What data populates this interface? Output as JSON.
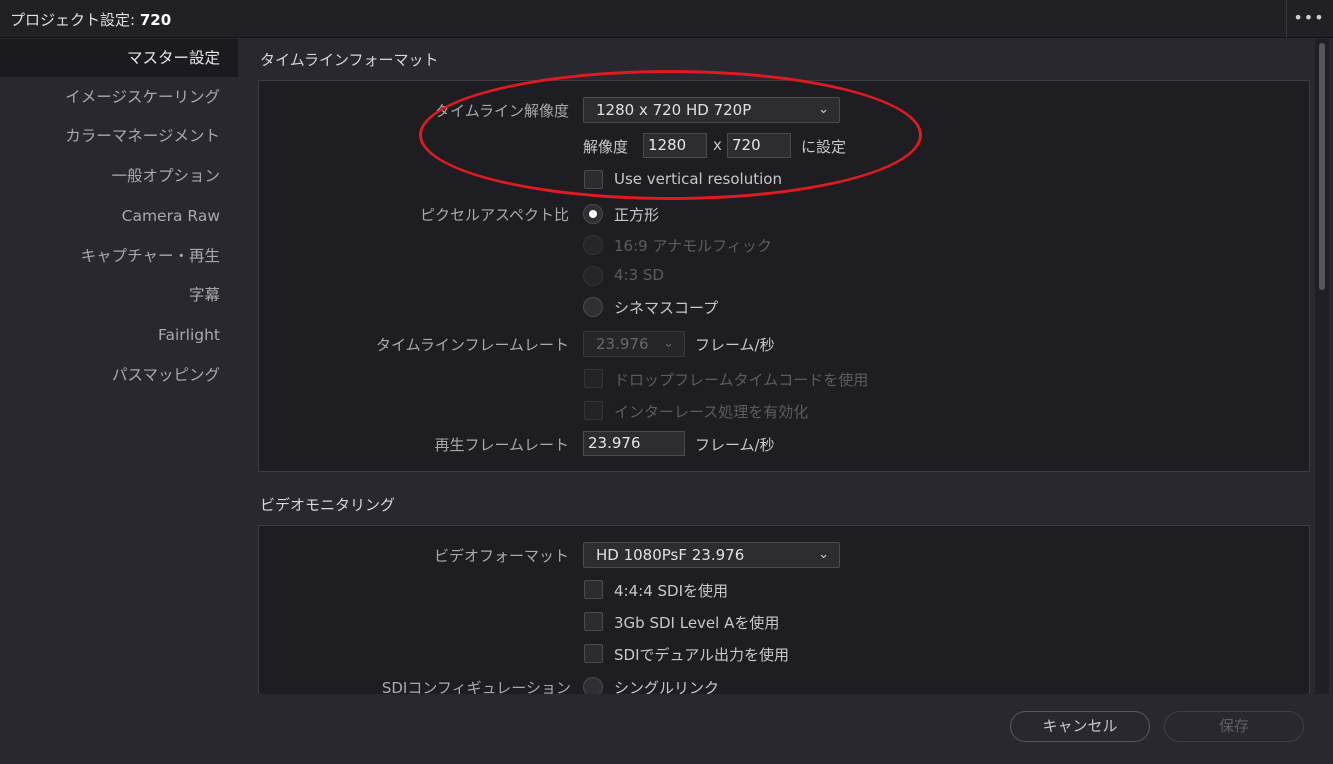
{
  "window": {
    "title_prefix": "プロジェクト設定:",
    "project_name": "720",
    "more_label": "•••"
  },
  "sidebar": {
    "items": [
      {
        "label": "マスター設定",
        "active": true
      },
      {
        "label": "イメージスケーリング"
      },
      {
        "label": "カラーマネージメント"
      },
      {
        "label": "一般オプション"
      },
      {
        "label": "Camera Raw"
      },
      {
        "label": "キャプチャー・再生"
      },
      {
        "label": "字幕"
      },
      {
        "label": "Fairlight"
      },
      {
        "label": "パスマッピング"
      }
    ]
  },
  "timeline_format": {
    "section_title": "タイムラインフォーマット",
    "resolution_label": "タイムライン解像度",
    "resolution_value": "1280 x 720 HD 720P",
    "custom_label": "解像度",
    "width": "1280",
    "x_label": "x",
    "height": "720",
    "set_label": "に設定",
    "vertical_label": "Use vertical resolution",
    "pixel_aspect_label": "ピクセルアスペクト比",
    "aspect_options": [
      "正方形",
      "16:9 アナモルフィック",
      "4:3 SD",
      "シネマスコープ"
    ],
    "frame_rate_label": "タイムラインフレームレート",
    "frame_rate_value": "23.976",
    "fps_unit": "フレーム/秒",
    "drop_frame_label": "ドロップフレームタイムコードを使用",
    "interlace_label": "インターレース処理を有効化",
    "playback_rate_label": "再生フレームレート",
    "playback_rate_value": "23.976",
    "playback_unit": "フレーム/秒"
  },
  "video_monitoring": {
    "section_title": "ビデオモニタリング",
    "format_label": "ビデオフォーマット",
    "format_value": "HD 1080PsF 23.976",
    "opt_444": "4:4:4 SDIを使用",
    "opt_3gb": "3Gb SDI Level Aを使用",
    "opt_dual": "SDIでデュアル出力を使用",
    "sdi_config_label": "SDIコンフィギュレーション",
    "sdi_config_value": "シングルリンク"
  },
  "footer": {
    "cancel_label": "キャンセル",
    "save_label": "保存"
  },
  "colors": {
    "highlight_ellipse": "#e01a22",
    "background": "#28282e",
    "panel": "#1e1e22"
  }
}
